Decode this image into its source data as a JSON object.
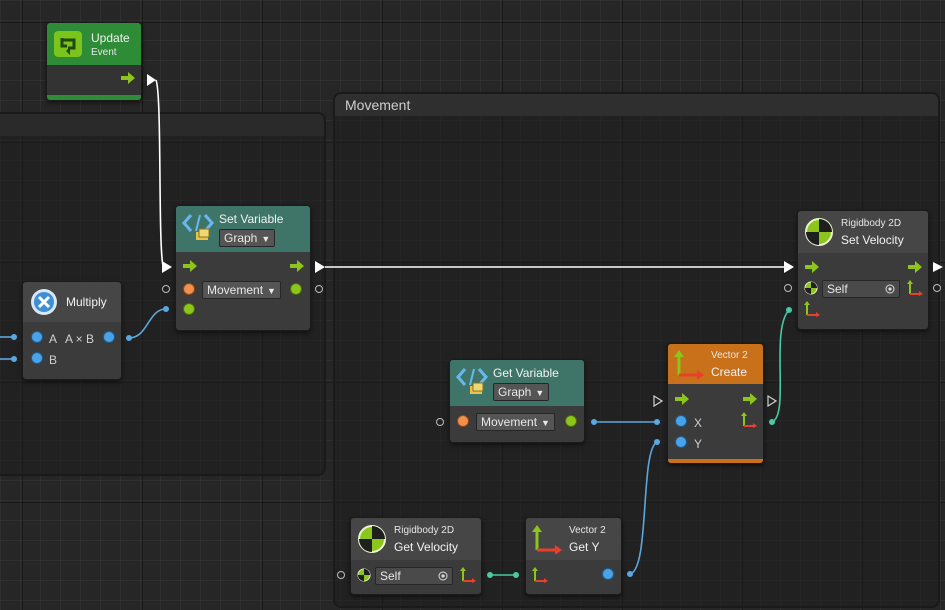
{
  "groups": {
    "movement_title": "Movement"
  },
  "nodes": {
    "update": {
      "title": "Update",
      "subtitle": "Event"
    },
    "multiply": {
      "title": "Multiply",
      "in_a": "A",
      "expr": "A × B",
      "in_b": "B"
    },
    "set_variable": {
      "title": "Set Variable",
      "scope": "Graph",
      "variable": "Movement"
    },
    "get_variable": {
      "title": "Get Variable",
      "scope": "Graph",
      "variable": "Movement"
    },
    "vector_create": {
      "category": "Vector 2",
      "title": "Create",
      "in_x": "X",
      "in_y": "Y"
    },
    "set_velocity": {
      "category": "Rigidbody 2D",
      "title": "Set Velocity",
      "target": "Self"
    },
    "get_velocity": {
      "category": "Rigidbody 2D",
      "title": "Get Velocity",
      "target": "Self"
    },
    "get_y": {
      "category": "Vector 2",
      "title": "Get Y"
    }
  },
  "colors": {
    "flow": "#ffffff",
    "value_edge_blue": "#5aa8e0",
    "value_edge_teal": "#49c9a4",
    "set_variable_header": "#3f7569",
    "vector_header": "#c9701b",
    "update_header": "#2e8b36"
  },
  "icons": {
    "update": "loop-event-icon",
    "multiply": "multiply-x-icon",
    "variable": "code-brackets-icon",
    "vector": "vector-axes-icon",
    "rigidbody": "rigidbody-circle-icon"
  }
}
